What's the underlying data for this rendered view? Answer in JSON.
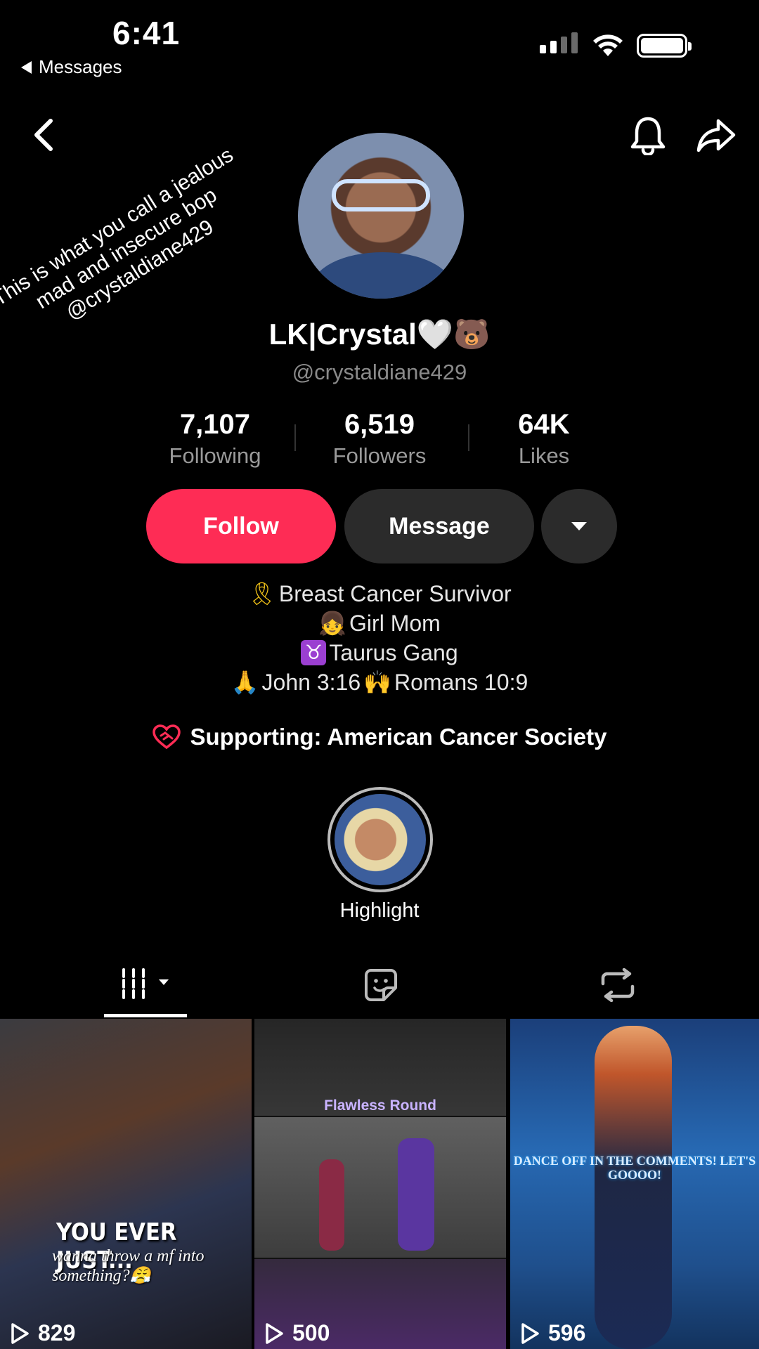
{
  "status_bar": {
    "time": "6:41",
    "back_app": "Messages"
  },
  "caption": {
    "lines": [
      "This is what you call a jealous",
      "mad and insecure bop",
      "@crystaldiane429"
    ]
  },
  "profile": {
    "display_name": "LK|Crystal🤍🐻",
    "handle": "@crystaldiane429",
    "stats": [
      {
        "value": "7,107",
        "label": "Following"
      },
      {
        "value": "6,519",
        "label": "Followers"
      },
      {
        "value": "64K",
        "label": "Likes"
      }
    ],
    "buttons": {
      "follow": "Follow",
      "message": "Message"
    },
    "bio": {
      "line1_emoji": "🎗",
      "line1": "Breast Cancer Survivor",
      "line2_emoji": "👧",
      "line2": "Girl Mom",
      "line3_emoji": "♉",
      "line3": "Taurus Gang",
      "line4_emoji_a": "🙏",
      "line4_a": "John 3:16",
      "line4_emoji_b": "🙌",
      "line4_b": "Romans 10:9"
    },
    "supporting": "Supporting: American Cancer Society",
    "highlight_label": "Highlight"
  },
  "grid": [
    {
      "views": "829",
      "text_top": "YOU EVER JUST...",
      "text_bottom": "wanna throw a mf into something?😤"
    },
    {
      "views": "500",
      "title": "Flawless Round"
    },
    {
      "views": "596",
      "text": "DANCE OFF IN THE COMMENTS! LET'S GOOOO!"
    }
  ],
  "colors": {
    "follow": "#fe2c55",
    "dark_button": "#2b2b2b",
    "muted_text": "#8a8a8a"
  },
  "icons": [
    "back-chevron-icon",
    "bell-icon",
    "share-arrow-icon",
    "videos-grid-icon",
    "liked-sticker-icon",
    "repost-icon",
    "play-icon"
  ]
}
